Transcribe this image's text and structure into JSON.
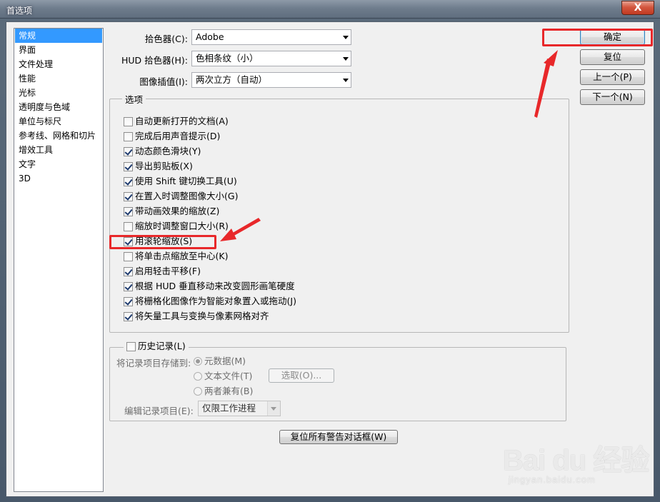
{
  "window": {
    "title": "首选项",
    "close_glyph": "X"
  },
  "sidebar": {
    "items": [
      {
        "label": "常规",
        "selected": true
      },
      {
        "label": "界面"
      },
      {
        "label": "文件处理"
      },
      {
        "label": "性能"
      },
      {
        "label": "光标"
      },
      {
        "label": "透明度与色域"
      },
      {
        "label": "单位与标尺"
      },
      {
        "label": "参考线、网格和切片"
      },
      {
        "label": "增效工具"
      },
      {
        "label": "文字"
      },
      {
        "label": "3D"
      }
    ]
  },
  "fields": {
    "color_picker": {
      "label": "拾色器(C):",
      "value": "Adobe"
    },
    "hud_color_picker": {
      "label": "HUD 拾色器(H):",
      "value": "色相条纹（小）"
    },
    "image_interpolation": {
      "label": "图像插值(I):",
      "value": "两次立方（自动）"
    }
  },
  "options": {
    "title": "选项",
    "checkboxes": [
      {
        "label": "自动更新打开的文档(A)",
        "checked": false
      },
      {
        "label": "完成后用声音提示(D)",
        "checked": false
      },
      {
        "label": "动态颜色滑块(Y)",
        "checked": true
      },
      {
        "label": "导出剪贴板(X)",
        "checked": true
      },
      {
        "label": "使用 Shift 键切换工具(U)",
        "checked": true
      },
      {
        "label": "在置入时调整图像大小(G)",
        "checked": true
      },
      {
        "label": "带动画效果的缩放(Z)",
        "checked": true
      },
      {
        "label": "缩放时调整窗口大小(R)",
        "checked": false
      },
      {
        "label": "用滚轮缩放(S)",
        "checked": true
      },
      {
        "label": "将单击点缩放至中心(K)",
        "checked": false
      },
      {
        "label": "启用轻击平移(F)",
        "checked": true
      },
      {
        "label": "根据 HUD 垂直移动来改变圆形画笔硬度",
        "checked": true
      },
      {
        "label": "将栅格化图像作为智能对象置入或拖动(J)",
        "checked": true
      },
      {
        "label": "将矢量工具与变换与像素网格对齐",
        "checked": true
      }
    ]
  },
  "history": {
    "title": "历史记录(L)",
    "checked": false,
    "save_to_label": "将记录项目存储到:",
    "radios": [
      {
        "label": "元数据(M)",
        "checked": true
      },
      {
        "label": "文本文件(T)",
        "checked": false
      },
      {
        "label": "两者兼有(B)",
        "checked": false
      }
    ],
    "choose_button": "选取(O)...",
    "edit_log_label": "编辑记录项目(E):",
    "edit_log_value": "仅限工作进程"
  },
  "reset_warnings_button": "复位所有警告对话框(W)",
  "buttons": {
    "ok": "确定",
    "reset": "复位",
    "prev": "上一个(P)",
    "next": "下一个(N)"
  },
  "watermark": {
    "main": "Bai du 经验",
    "sub": "jingyan.baidu.com"
  },
  "colors": {
    "highlight": "#e8282a",
    "selection": "#3399ff"
  }
}
